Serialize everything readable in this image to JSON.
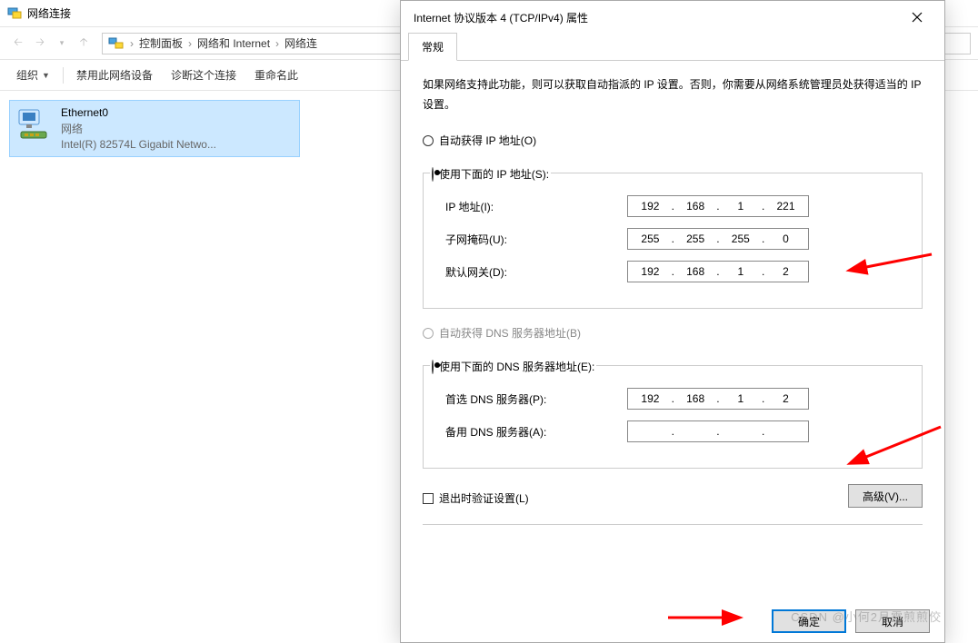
{
  "explorer": {
    "title": "网络连接",
    "breadcrumb": [
      "控制面板",
      "网络和 Internet",
      "网络连"
    ],
    "toolbar": {
      "organize": "组织",
      "disable": "禁用此网络设备",
      "diagnose": "诊断这个连接",
      "rename": "重命名此"
    },
    "nic": {
      "name": "Ethernet0",
      "status": "网络",
      "adapter": "Intel(R) 82574L Gigabit Netwo..."
    }
  },
  "dialog": {
    "title": "Internet 协议版本 4 (TCP/IPv4) 属性",
    "tab": "常规",
    "desc": "如果网络支持此功能，则可以获取自动指派的 IP 设置。否则，你需要从网络系统管理员处获得适当的 IP 设置。",
    "radio_auto_ip": "自动获得 IP 地址(O)",
    "radio_manual_ip": "使用下面的 IP 地址(S):",
    "ip_label": "IP 地址(I):",
    "mask_label": "子网掩码(U):",
    "gw_label": "默认网关(D):",
    "radio_auto_dns": "自动获得 DNS 服务器地址(B)",
    "radio_manual_dns": "使用下面的 DNS 服务器地址(E):",
    "dns1_label": "首选 DNS 服务器(P):",
    "dns2_label": "备用 DNS 服务器(A):",
    "ip": {
      "a": "192",
      "b": "168",
      "c": "1",
      "d": "221"
    },
    "mask": {
      "a": "255",
      "b": "255",
      "c": "255",
      "d": "0"
    },
    "gw": {
      "a": "192",
      "b": "168",
      "c": "1",
      "d": "2"
    },
    "dns1": {
      "a": "192",
      "b": "168",
      "c": "1",
      "d": "2"
    },
    "dns2": {
      "a": "",
      "b": "",
      "c": "",
      "d": ""
    },
    "validate": "退出时验证设置(L)",
    "advanced": "高级(V)...",
    "ok": "确定",
    "cancel": "取消"
  },
  "watermark": "CSDN @小何2月露煎煎佼"
}
